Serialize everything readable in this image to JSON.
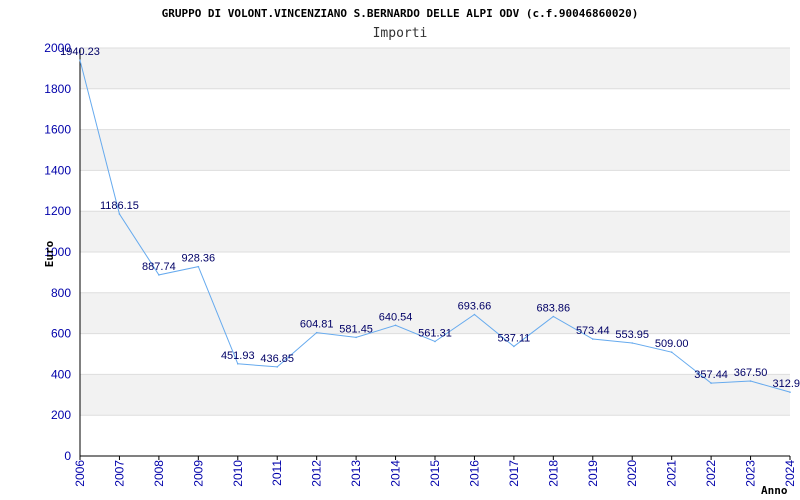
{
  "chart_data": {
    "type": "line",
    "title": "GRUPPO DI VOLONT.VINCENZIANO S.BERNARDO DELLE ALPI ODV (c.f.90046860020)",
    "subtitle": "Importi",
    "ylabel": "Euro",
    "xlabel": "Anno",
    "ylim": [
      0,
      2000
    ],
    "yticks": [
      "0",
      "200",
      "400",
      "600",
      "800",
      "1000",
      "1200",
      "1400",
      "1600",
      "1800",
      "2000"
    ],
    "grid": true,
    "x": [
      "2006",
      "2007",
      "2008",
      "2009",
      "2010",
      "2011",
      "2012",
      "2013",
      "2014",
      "2015",
      "2016",
      "2017",
      "2018",
      "2019",
      "2020",
      "2021",
      "2022",
      "2023",
      "2024"
    ],
    "values": [
      1940.23,
      1186.15,
      887.74,
      928.36,
      451.93,
      436.85,
      604.81,
      581.45,
      640.54,
      561.31,
      693.66,
      537.11,
      683.86,
      573.44,
      553.95,
      509.0,
      357.44,
      367.5,
      312.9
    ],
    "labels": [
      "1940.23",
      "1186.15",
      "887.74",
      "928.36",
      "451.93",
      "436.85",
      "604.81",
      "581.45",
      "640.54",
      "561.31",
      "693.66",
      "537.11",
      "683.86",
      "573.44",
      "553.95",
      "509.00",
      "357.44",
      "367.50",
      "312.9"
    ],
    "colors": {
      "line": "#66aaee",
      "band": "#f2f2f2",
      "grid": "#dddddd",
      "tick": "#0000aa",
      "label": "#000066"
    }
  }
}
